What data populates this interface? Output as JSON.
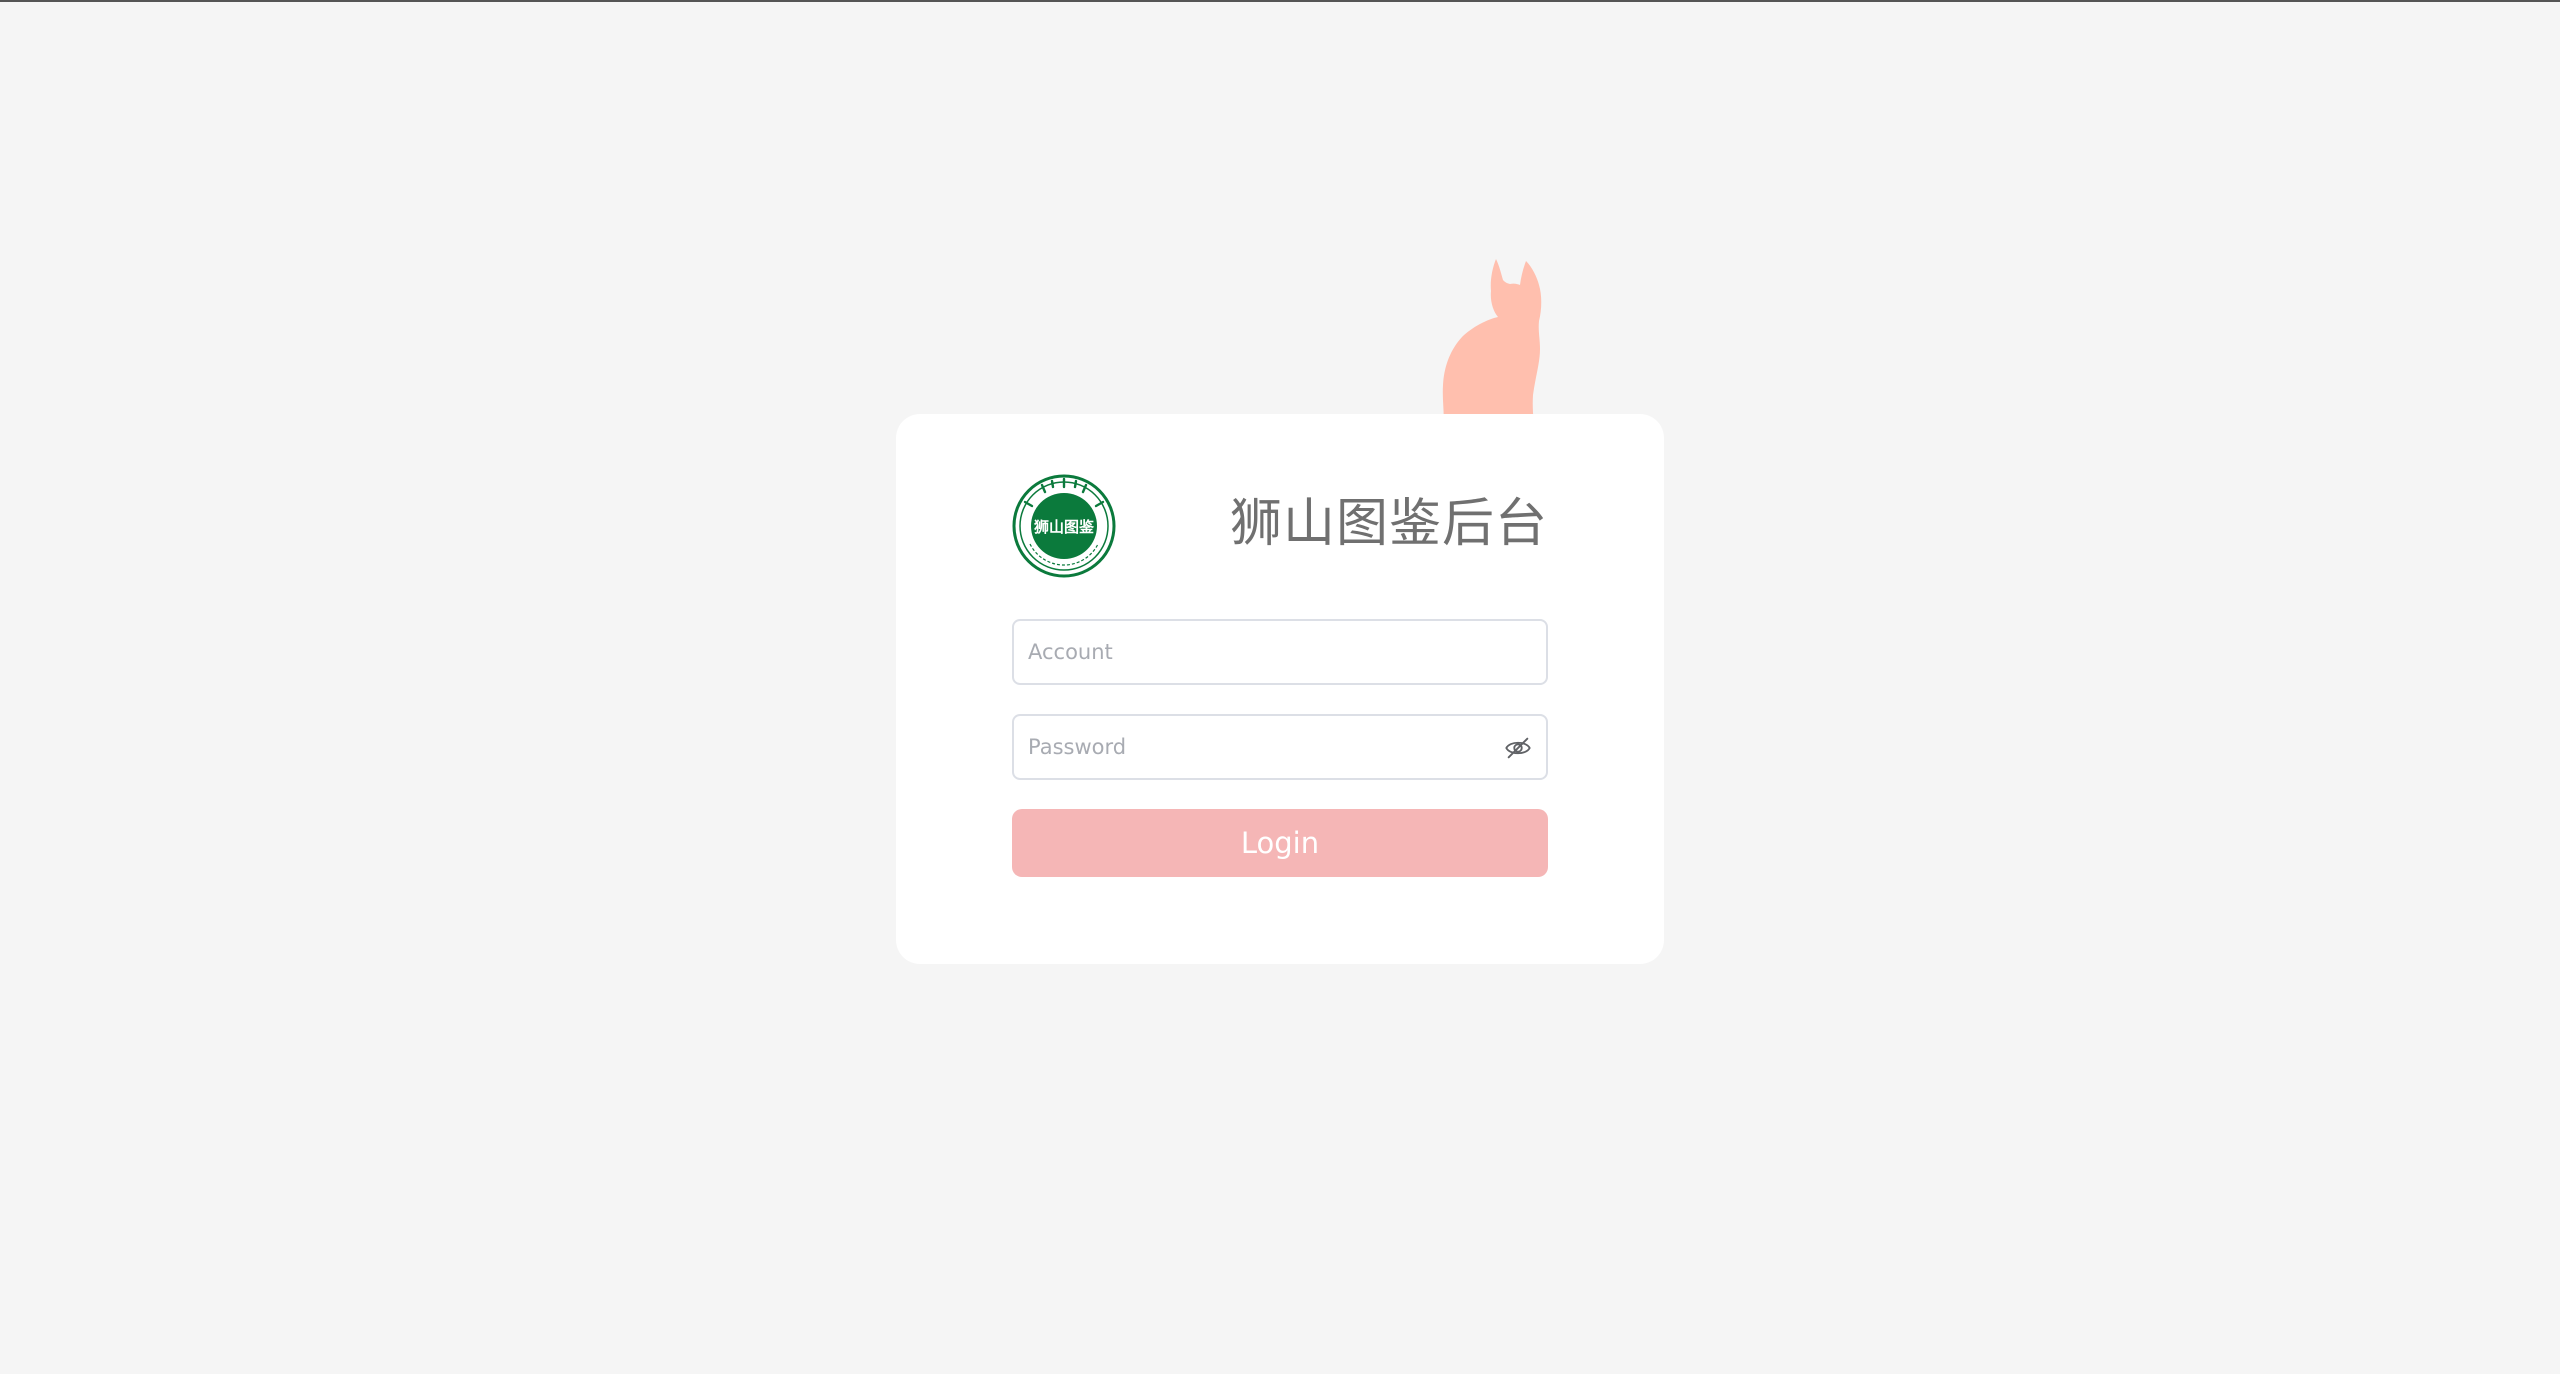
{
  "page": {
    "background_color": "#f5f5f5",
    "accent_color": "#f5b6b6",
    "cat_color": "#ffbfae"
  },
  "brand": {
    "logo_icon": "shishan-emblem-icon",
    "logo_text": "狮山图鉴",
    "logo_color": "#0b7a3c"
  },
  "login": {
    "title": "狮山图鉴后台",
    "account_placeholder": "Account",
    "password_placeholder": "Password",
    "password_toggle_icon": "eye-off-icon",
    "login_label": "Login"
  }
}
